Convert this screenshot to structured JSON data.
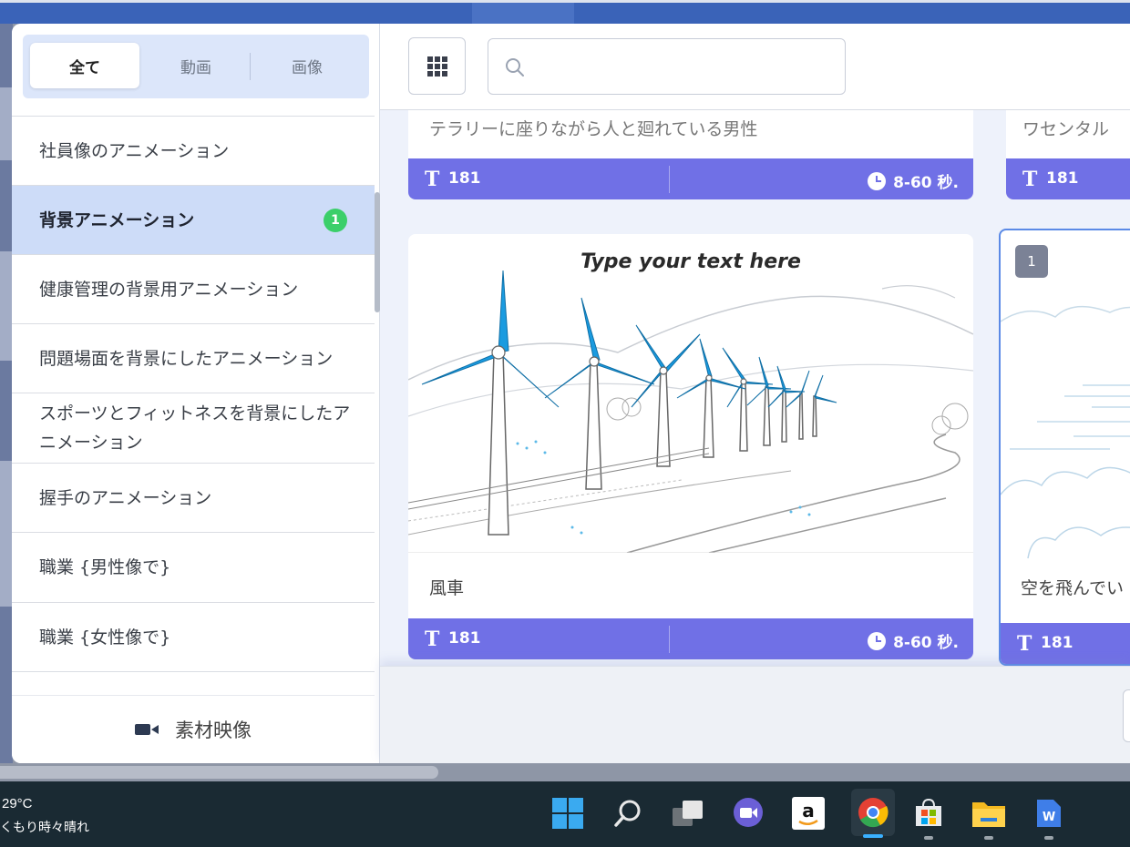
{
  "filter_tabs": {
    "all": "全て",
    "video": "動画",
    "image": "画像"
  },
  "categories": [
    {
      "label": "社員像のアニメーション",
      "badge": ""
    },
    {
      "label": "背景アニメーション",
      "badge": "1"
    },
    {
      "label": "健康管理の背景用アニメーション",
      "badge": ""
    },
    {
      "label": "問題場面を背景にしたアニメーション",
      "badge": ""
    },
    {
      "label": "スポーツとフィットネスを背景にしたアニメーション",
      "badge": ""
    },
    {
      "label": "握手のアニメーション",
      "badge": ""
    },
    {
      "label": "職業 {男性像で}",
      "badge": ""
    },
    {
      "label": "職業 {女性像で}",
      "badge": ""
    }
  ],
  "stock_footer": {
    "label": "素材映像",
    "icon": "video-camera-icon"
  },
  "search": {
    "placeholder": ""
  },
  "cards_top_row": [
    {
      "title": "テラリーに座りながら人と廻れている男性",
      "text_count": "181",
      "duration": "8-60 秒."
    },
    {
      "title": "ワセンタル",
      "text_count": "181"
    }
  ],
  "cards": [
    {
      "title": "風車",
      "caption": "Type your text here",
      "text_count": "181",
      "duration": "8-60 秒."
    },
    {
      "title": "空を飛んでい",
      "selected_number": "1",
      "text_count": "181"
    }
  ],
  "taskbar": {
    "temperature": "29°C",
    "weather": "くもり時々晴れ",
    "apps": [
      "windows-start",
      "search",
      "task-view",
      "meet",
      "amazon",
      "chrome",
      "microsoft-store",
      "file-explorer",
      "writer"
    ]
  },
  "colors": {
    "accent_bar": "#7070e6",
    "active_category_bg": "#cddcf8",
    "badge_green": "#3bcf6a",
    "selection_border": "#5b8ae6",
    "windmill_blue": "#1a9be0"
  }
}
